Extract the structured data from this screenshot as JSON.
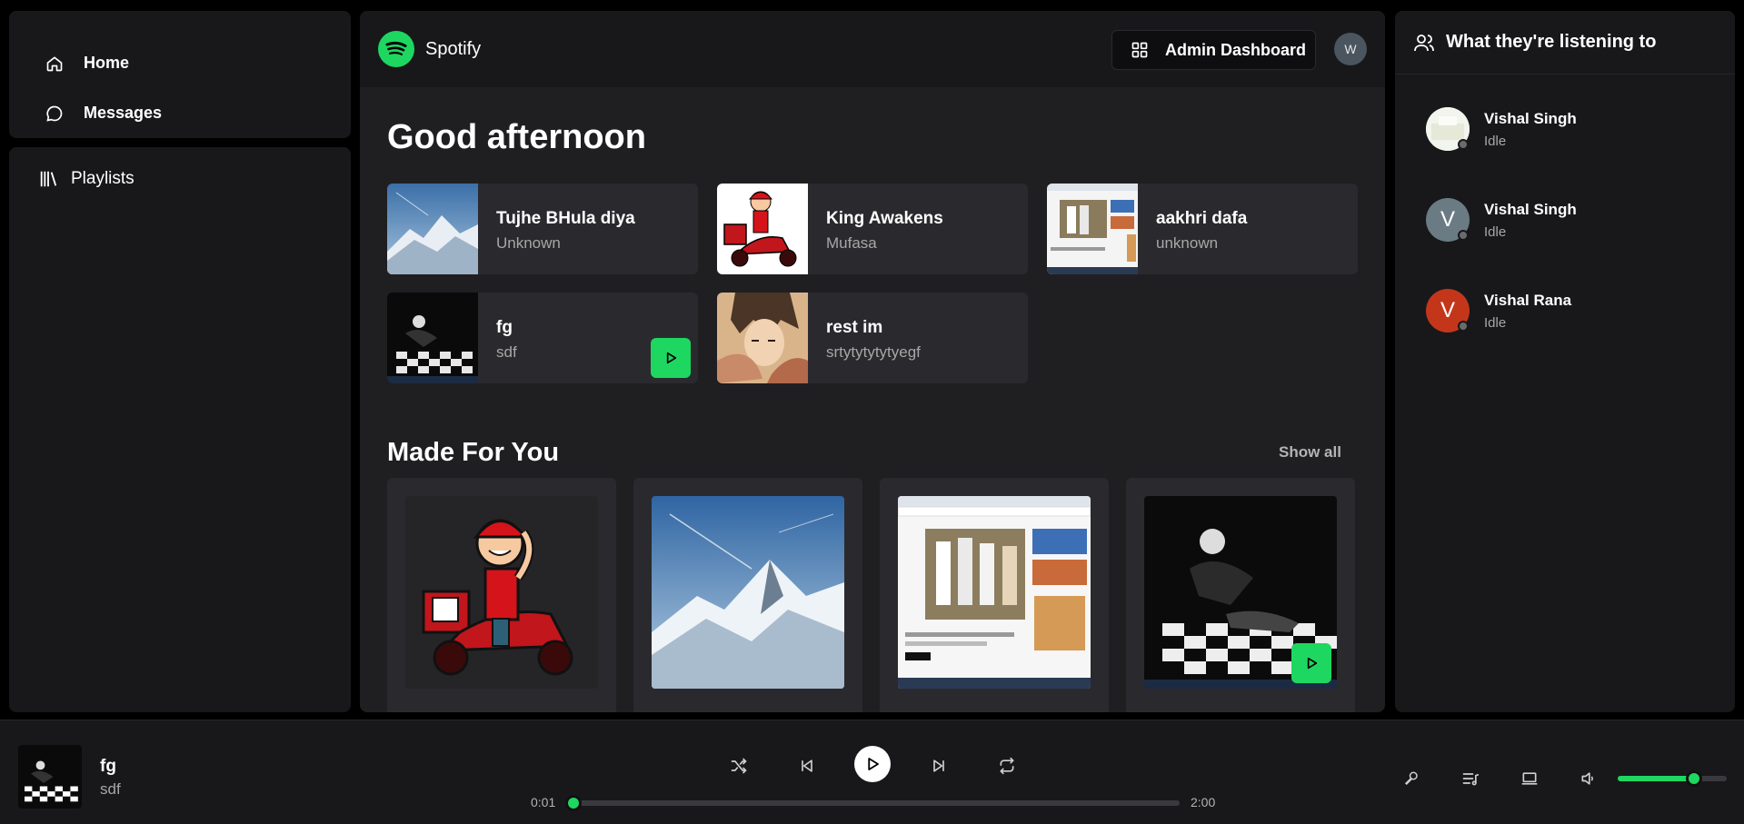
{
  "sidebar": {
    "nav": [
      {
        "label": "Home",
        "icon": "home-icon"
      },
      {
        "label": "Messages",
        "icon": "message-icon"
      }
    ],
    "library": {
      "label": "Playlists",
      "icon": "library-icon"
    }
  },
  "header": {
    "brand": "Spotify",
    "admin_button": "Admin Dashboard",
    "user_initial": "W"
  },
  "main": {
    "greeting": "Good afternoon",
    "quick": [
      {
        "title": "Tujhe BHula diya",
        "subtitle": "Unknown"
      },
      {
        "title": "King Awakens",
        "subtitle": "Mufasa"
      },
      {
        "title": "aakhri dafa",
        "subtitle": "unknown"
      },
      {
        "title": "fg",
        "subtitle": "sdf"
      },
      {
        "title": "rest im",
        "subtitle": "srtytytytytyegf"
      }
    ],
    "made_for_you": {
      "title": "Made For You",
      "show_all": "Show all"
    }
  },
  "friends": {
    "title": "What they're listening to",
    "list": [
      {
        "name": "Vishal Singh",
        "status": "Idle",
        "initial": ""
      },
      {
        "name": "Vishal Singh",
        "status": "Idle",
        "initial": "V"
      },
      {
        "name": "Vishal Rana",
        "status": "Idle",
        "initial": "V"
      }
    ]
  },
  "player": {
    "title": "fg",
    "artist": "sdf",
    "current_time": "0:01",
    "duration": "2:00",
    "progress_fraction": 0.01,
    "volume_fraction": 0.7
  },
  "colors": {
    "accent": "#1ed760",
    "panel": "#18181b",
    "card": "#2a2a2e"
  }
}
